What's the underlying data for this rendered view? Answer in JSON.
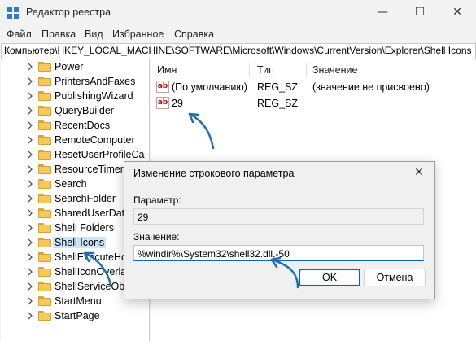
{
  "window": {
    "title": "Редактор реестра",
    "controls": {
      "minimize": "—",
      "maximize": "☐",
      "close": "✕"
    }
  },
  "menu": [
    "Файл",
    "Правка",
    "Вид",
    "Избранное",
    "Справка"
  ],
  "address": "Компьютер\\HKEY_LOCAL_MACHINE\\SOFTWARE\\Microsoft\\Windows\\CurrentVersion\\Explorer\\Shell Icons",
  "tree": {
    "items": [
      {
        "label": "Power"
      },
      {
        "label": "PrintersAndFaxes"
      },
      {
        "label": "PublishingWizard"
      },
      {
        "label": "QueryBuilder"
      },
      {
        "label": "RecentDocs"
      },
      {
        "label": "RemoteComputer"
      },
      {
        "label": "ResetUserProfileCa"
      },
      {
        "label": "ResourceTimers"
      },
      {
        "label": "Search"
      },
      {
        "label": "SearchFolder"
      },
      {
        "label": "SharedUserData"
      },
      {
        "label": "Shell Folders"
      },
      {
        "label": "Shell Icons"
      },
      {
        "label": "ShellExecuteHoo"
      },
      {
        "label": "ShellIconOverlay"
      },
      {
        "label": "ShellServiceObje"
      },
      {
        "label": "StartMenu"
      },
      {
        "label": "StartPage"
      }
    ],
    "selected_index": 12
  },
  "values": {
    "columns": [
      "Имя",
      "Тип",
      "Значение"
    ],
    "rows": [
      {
        "name": "(По умолчанию)",
        "type": "REG_SZ",
        "data": "(значение не присвоено)"
      },
      {
        "name": "29",
        "type": "REG_SZ",
        "data": ""
      }
    ],
    "icon_text": "ab"
  },
  "dialog": {
    "title": "Изменение строкового параметра",
    "close": "✕",
    "name_label": "Параметр:",
    "name_value": "29",
    "value_label": "Значение:",
    "value_value": "%windir%\\System32\\shell32.dll,-50",
    "ok_label": "OK",
    "cancel_label": "Отмена"
  },
  "colors": {
    "accent": "#0067c0",
    "arrow": "#1e6fb8",
    "selection": "#cce4f7",
    "folder": "#f7c85a"
  }
}
